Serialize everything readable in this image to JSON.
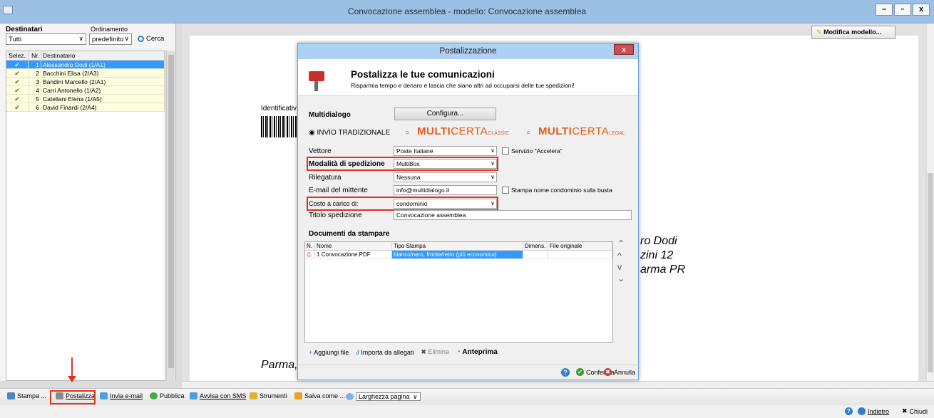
{
  "window": {
    "title": "Convocazione assemblea - modello: Convocazione assemblea"
  },
  "left": {
    "destinatari_label": "Destinatari",
    "ordinamento_label": "Ordinamento",
    "destinatari_value": "Tutti",
    "ordinamento_value": "predefinito",
    "search_label": "Cerca",
    "columns": [
      "Selez.",
      "Nr.",
      "Destinatario"
    ],
    "rows": [
      {
        "nr": "1",
        "name": "Alessandro Dodi (1/A1)"
      },
      {
        "nr": "2",
        "name": "Bacchini Elisa (2/A3)"
      },
      {
        "nr": "3",
        "name": "Bandini Marcello (2/A1)"
      },
      {
        "nr": "4",
        "name": "Carri Antonello (1/A2)"
      },
      {
        "nr": "5",
        "name": "Catellani Elena (1/A5)"
      },
      {
        "nr": "6",
        "name": "David Finardi (2/A4)"
      }
    ]
  },
  "preview": {
    "modifica_label": "Modifica modello...",
    "identificativo": "Identificativ",
    "addr1": "ro Dodi",
    "addr2": "zini 12",
    "addr3": "arma PR",
    "footer": "Parma,"
  },
  "dialog": {
    "title": "Postalizzazione",
    "header_title": "Postalizza le tue comunicazioni",
    "header_sub": "Risparmia tempo e denaro e lascia che siano altri ad occuparsi delle tue spedizioni!",
    "multidialogo_label": "Multidialogo",
    "configura_label": "Configura...",
    "radio_tradizionale": "INVIO TRADIZIONALE",
    "multicerta_main": "MULTI",
    "multicerta_rest": "CERTA",
    "multicerta_classic": "CLASSIC",
    "multicerta_legal": "LEGAL",
    "vettore_label": "Vettore",
    "vettore_value": "Poste Italiane",
    "accelera_label": "Servizio \"Accelera\"",
    "modalita_label": "Modalità di spedizione",
    "modalita_value": "MultiBox",
    "rilegatura_label": "Rilegatura",
    "rilegatura_value": "Nessuna",
    "email_label": "E-mail del mittente",
    "email_value": "info@multidialogo.it",
    "stampa_nome_label": "Stampa nome condominio sulla busta",
    "costo_label": "Costo a carico di:",
    "costo_value": "condominio",
    "titolo_label": "Titolo spedizione",
    "titolo_value": "Convocazione assemblea",
    "documenti_label": "Documenti da stampare",
    "doc_columns": [
      "N.",
      "Nome",
      "Tipo Stampa",
      "Dimens.",
      "File originale"
    ],
    "doc_rows": [
      {
        "n": "1",
        "nome": "Convocazione.PDF",
        "tipo": "bianco/nero, fronte/retro (più economico)",
        "dim": "",
        "file": ""
      }
    ],
    "aggiungi_label": "Aggiungi file",
    "importa_label": "Importa da allegati",
    "elimina_label": "Elimina",
    "anteprima_label": "Anteprima",
    "conferma_label": "Conferma",
    "annulla_label": "Annulla"
  },
  "toolbar": {
    "stampa": "Stampa ...",
    "postalizza": "Postalizza",
    "invia_email": "Invia e-mail",
    "pubblica": "Pubblica",
    "avvisa_sms": "Avvisa con SMS",
    "strumenti": "Strumenti",
    "salva_come": "Salva come ...",
    "zoom_value": "Larghezza pagina"
  },
  "status": {
    "indietro": "Indietro",
    "chiudi": "Chiudi"
  }
}
